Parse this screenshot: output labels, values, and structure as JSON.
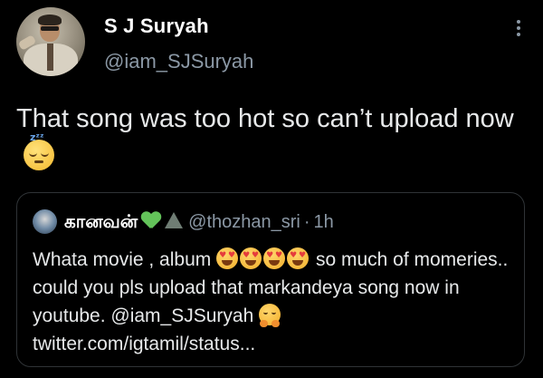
{
  "author": {
    "display_name": "S J Suryah",
    "handle": "@iam_SJSuryah",
    "avatar_icon": "profile-photo"
  },
  "menu_icon": "more-vertical-icon",
  "tweet": {
    "text": "That song was too hot so can’t upload now",
    "emoji": "sleeping-face-emoji"
  },
  "quoted_tweet": {
    "display_name": "கானவன்",
    "name_emojis": [
      "green-heart-emoji",
      "mountain-emoji"
    ],
    "handle": "@thozhan_sri",
    "separator": "·",
    "time": "1h",
    "text_part1": "Whata movie , album",
    "text_emojis": [
      "heart-eyes-emoji",
      "heart-eyes-emoji",
      "heart-eyes-emoji",
      "heart-eyes-emoji"
    ],
    "text_part2": "so much  of momeries.. could you pls upload that markandeya song now in youtube.  @iam_SJSuryah",
    "text_emoji_end": "hugging-face-emoji",
    "text_part3": "twitter.com/igtamil/status..."
  },
  "colors": {
    "background": "#000000",
    "primary_text": "#e7e9ea",
    "secondary_text": "#8b98a5",
    "border": "#2f3336",
    "green_heart": "#63c35a"
  }
}
